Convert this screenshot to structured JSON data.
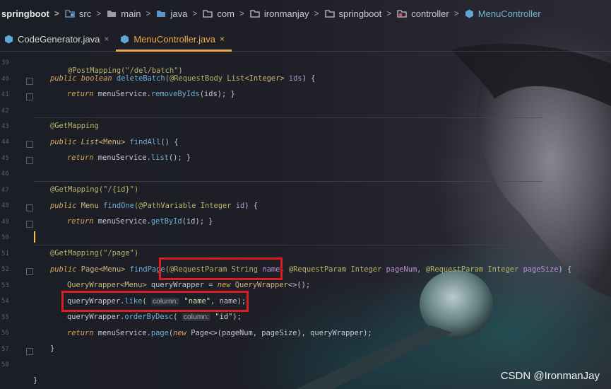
{
  "breadcrumb": [
    {
      "label": "springboot",
      "icon": "none"
    },
    {
      "label": "src",
      "icon": "source-folder-icon"
    },
    {
      "label": "main",
      "icon": "folder-icon"
    },
    {
      "label": "java",
      "icon": "folder-icon"
    },
    {
      "label": "com",
      "icon": "package-icon"
    },
    {
      "label": "ironmanjay",
      "icon": "package-icon"
    },
    {
      "label": "springboot",
      "icon": "package-icon"
    },
    {
      "label": "controller",
      "icon": "controller-package-icon"
    },
    {
      "label": "MenuController",
      "icon": "java-class-icon"
    }
  ],
  "tabs": [
    {
      "label": "CodeGenerator.java",
      "close": "×"
    },
    {
      "label": "MenuController.java",
      "close": "×"
    }
  ],
  "line_numbers": [
    "39",
    "40",
    "41",
    "42",
    "43",
    "44",
    "45",
    "46",
    "47",
    "48",
    "49",
    "50",
    "51",
    "52",
    "53",
    "54",
    "55",
    "56",
    "57",
    "58",
    "59",
    "60",
    "61",
    "62"
  ],
  "code": {
    "l1_ann": "@PostMapping(\"/del/batch\")",
    "l2_kw": "public boolean",
    "l2_fn": "deleteBatch",
    "l2_a": "(@RequestBody ",
    "l2_ty": "List",
    "l2_b": "<Integer> ",
    "l2_p": "ids",
    "l2_c": ") {",
    "l3_kw": "return ",
    "l3_a": "menuService.",
    "l3_fn": "removeByIds",
    "l3_b": "(ids); }",
    "l4_ann": "@GetMapping",
    "l5_kw": "public ",
    "l5_ty": "List",
    "l5_a": "<Menu> ",
    "l5_fn": "findAll",
    "l5_b": "() {",
    "l6_kw": "return ",
    "l6_a": "menuService.",
    "l6_fn": "list",
    "l6_b": "(); }",
    "l7_ann": "@GetMapping(\"/{id}\")",
    "l8_kw": "public ",
    "l8_a": "Menu ",
    "l8_fn": "findOne",
    "l8_b": "(@PathVariable Integer ",
    "l8_p": "id",
    "l8_c": ") {",
    "l9_kw": "return ",
    "l9_a": "menuService.",
    "l9_fn": "getById",
    "l9_b": "(id); }",
    "l10_ann": "@GetMapping(\"/page\")",
    "l11_kw": "public ",
    "l11_a": "Page<Menu> ",
    "l11_fn": "findPage",
    "l11_b": "(@RequestParam String ",
    "l11_p1": "name",
    ", ": ", ",
    "l11_c": "@RequestParam Integer ",
    "l11_p2": "pageNum",
    "l11_d": ", @RequestParam Integer ",
    "l11_p3": "pageSize",
    "l11_e": ") {",
    "l12_ty": "QueryWrapper<Menu>",
    "l12_a": " queryWrapper = ",
    "l12_kw": "new ",
    "l12_ty2": "QueryWrapper",
    "l12_b": "<>();",
    "l13_a": "queryWrapper.",
    "l13_fn": "like",
    "l13_b": "( ",
    "l13_hint": "column:",
    "l13_str": " \"name\"",
    "l13_c": ", name);",
    "l14_a": "queryWrapper.",
    "l14_fn": "orderByDesc",
    "l14_b": "( ",
    "l14_hint": "column:",
    "l14_str": " \"id\"",
    "l14_c": ");",
    "l15_kw": "return ",
    "l15_a": "menuService.",
    "l15_fn": "page",
    "l15_b": "(",
    "l15_kw2": "new ",
    "l15_c": "Page<>(pageNum, pageSize), queryWrapper);",
    "l16": "}",
    "l17": "}"
  },
  "watermark": "CSDN @IronmanJay",
  "colors": {
    "accent_tab": "#f0a94b",
    "highlight_box": "#d91e24",
    "annotation": "#b9b36a",
    "keyword": "#d7a55d",
    "function": "#6fb0d8",
    "string": "#c9e6b1"
  }
}
